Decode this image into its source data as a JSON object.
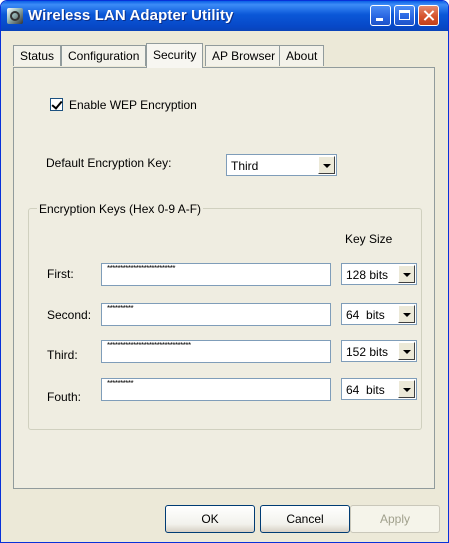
{
  "window": {
    "title": "Wireless LAN Adapter Utility"
  },
  "tabs": [
    "Status",
    "Configuration",
    "Security",
    "AP Browser",
    "About"
  ],
  "active_tab": "Security",
  "wep": {
    "label": "Enable WEP Encryption",
    "checked": true
  },
  "default_key": {
    "label": "Default Encryption Key:",
    "value": "Third"
  },
  "keys_group": {
    "title": "Encryption Keys  (Hex 0-9 A-F)",
    "key_size_header": "Key Size",
    "rows": [
      {
        "label": "First:",
        "masked": "**************************",
        "size": "128 bits"
      },
      {
        "label": "Second:",
        "masked": "**********",
        "size": "64  bits"
      },
      {
        "label": "Third:",
        "masked": "********************************",
        "size": "152 bits"
      },
      {
        "label": "Fouth:",
        "masked": "**********",
        "size": "64  bits"
      }
    ]
  },
  "buttons": {
    "ok": "OK",
    "cancel": "Cancel",
    "apply": "Apply"
  },
  "icons": [
    "app-icon",
    "minimize-icon",
    "maximize-icon",
    "close-icon",
    "checkmark-icon",
    "dropdown-arrow-icon"
  ]
}
